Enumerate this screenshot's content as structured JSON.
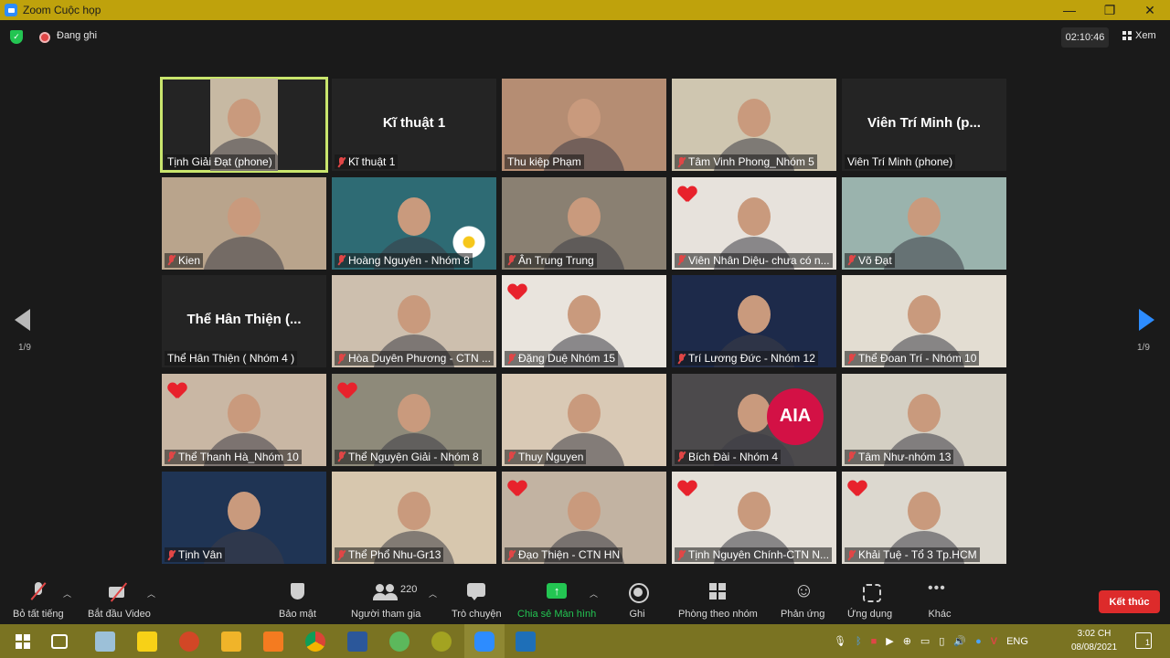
{
  "window": {
    "title": "Zoom Cuộc họp"
  },
  "topbar": {
    "recording_label": "Đang ghi",
    "timer": "02:10:46",
    "view_label": "Xem"
  },
  "pager": {
    "left": "1/9",
    "right": "1/9"
  },
  "tiles": [
    {
      "name": "Tịnh Giải Đạt (phone)",
      "muted": false,
      "active": true,
      "heart": false,
      "avatar_text": "",
      "video": "#c7b9a3"
    },
    {
      "name": "Kĩ thuật 1",
      "muted": true,
      "active": false,
      "heart": false,
      "avatar_text": "Kĩ thuật 1",
      "video": ""
    },
    {
      "name": "Thu kiệp Phạm",
      "muted": false,
      "active": false,
      "heart": false,
      "avatar_text": "",
      "video": "#b58d73"
    },
    {
      "name": "Tâm Vinh Phong_Nhóm 5",
      "muted": true,
      "active": false,
      "heart": false,
      "avatar_text": "",
      "video": "#cfc6b0"
    },
    {
      "name": "Viên Trí Minh (phone)",
      "muted": false,
      "active": false,
      "heart": false,
      "avatar_text": "Viên Trí Minh (p...",
      "video": ""
    },
    {
      "name": "Kien",
      "muted": true,
      "active": false,
      "heart": false,
      "avatar_text": "",
      "video": "#b9a48c"
    },
    {
      "name": "Hoàng Nguyên - Nhóm 8",
      "muted": true,
      "active": false,
      "heart": false,
      "avatar_text": "",
      "video": "#2e6b74"
    },
    {
      "name": "Ân Trung Trung",
      "muted": true,
      "active": false,
      "heart": false,
      "avatar_text": "",
      "video": "#8a8072"
    },
    {
      "name": "Viên Nhân Diệu- chưa có n...",
      "muted": true,
      "active": false,
      "heart": true,
      "avatar_text": "",
      "video": "#e7e2dc"
    },
    {
      "name": "Võ Đạt",
      "muted": true,
      "active": false,
      "heart": false,
      "avatar_text": "",
      "video": "#9ab3ad"
    },
    {
      "name": "Thể Hân Thiện ( Nhóm 4 )",
      "muted": false,
      "active": false,
      "heart": false,
      "avatar_text": "Thể Hân Thiện (...",
      "video": ""
    },
    {
      "name": "Hòa Duyên Phương - CTN ...",
      "muted": true,
      "active": false,
      "heart": false,
      "avatar_text": "",
      "video": "#cdbfae"
    },
    {
      "name": "Đặng Duệ Nhóm 15",
      "muted": true,
      "active": false,
      "heart": true,
      "avatar_text": "",
      "video": "#e9e4dd"
    },
    {
      "name": "Trí Lương Đức - Nhóm 12",
      "muted": true,
      "active": false,
      "heart": false,
      "avatar_text": "",
      "video": "#1d2a4a"
    },
    {
      "name": "Thể Đoan Trí - Nhóm 10",
      "muted": true,
      "active": false,
      "heart": false,
      "avatar_text": "",
      "video": "#e3ddd2"
    },
    {
      "name": "Thể Thanh Hà_Nhóm 10",
      "muted": true,
      "active": false,
      "heart": true,
      "avatar_text": "",
      "video": "#c9b7a4"
    },
    {
      "name": "Thể Nguyện Giải - Nhóm 8",
      "muted": true,
      "active": false,
      "heart": true,
      "avatar_text": "",
      "video": "#8e8a7a"
    },
    {
      "name": "Thuy Nguyen",
      "muted": true,
      "active": false,
      "heart": false,
      "avatar_text": "",
      "video": "#d9c9b5"
    },
    {
      "name": "Bích Đài - Nhóm 4",
      "muted": true,
      "active": false,
      "heart": false,
      "avatar_text": "",
      "video": "#4c4a4c",
      "badge": "AIA"
    },
    {
      "name": "Tâm Như-nhóm 13",
      "muted": true,
      "active": false,
      "heart": false,
      "avatar_text": "",
      "video": "#d4cfc3"
    },
    {
      "name": "Tịnh Vân",
      "muted": true,
      "active": false,
      "heart": false,
      "avatar_text": "",
      "video": "#1f3454"
    },
    {
      "name": "Thể Phổ Nhu-Gr13",
      "muted": true,
      "active": false,
      "heart": false,
      "avatar_text": "",
      "video": "#d7c7ae"
    },
    {
      "name": "Đạo Thiện - CTN HN",
      "muted": true,
      "active": false,
      "heart": true,
      "avatar_text": "",
      "video": "#c2b3a2"
    },
    {
      "name": "Tịnh Nguyên Chính-CTN N...",
      "muted": true,
      "active": false,
      "heart": true,
      "avatar_text": "",
      "video": "#e5e0d8"
    },
    {
      "name": "Khải Tuệ - Tổ 3 Tp.HCM",
      "muted": true,
      "active": false,
      "heart": true,
      "avatar_text": "",
      "video": "#dcd8cf"
    }
  ],
  "toolbar": {
    "mute_all": "Bỏ tất tiếng",
    "start_video": "Bắt đầu Video",
    "security": "Bảo mật",
    "participants": "Người tham gia",
    "participants_count": "220",
    "chat": "Trò chuyện",
    "share_screen": "Chia sẻ Màn hình",
    "record": "Ghi",
    "breakout_rooms": "Phòng theo nhóm",
    "reactions": "Phản ứng",
    "apps": "Ứng dụng",
    "more": "Khác",
    "end": "Kết thúc"
  },
  "taskbar": {
    "language": "ENG",
    "time": "3:02 CH",
    "date": "08/08/2021",
    "notifications": "1",
    "colors": {
      "bar": "#7a7322"
    }
  }
}
